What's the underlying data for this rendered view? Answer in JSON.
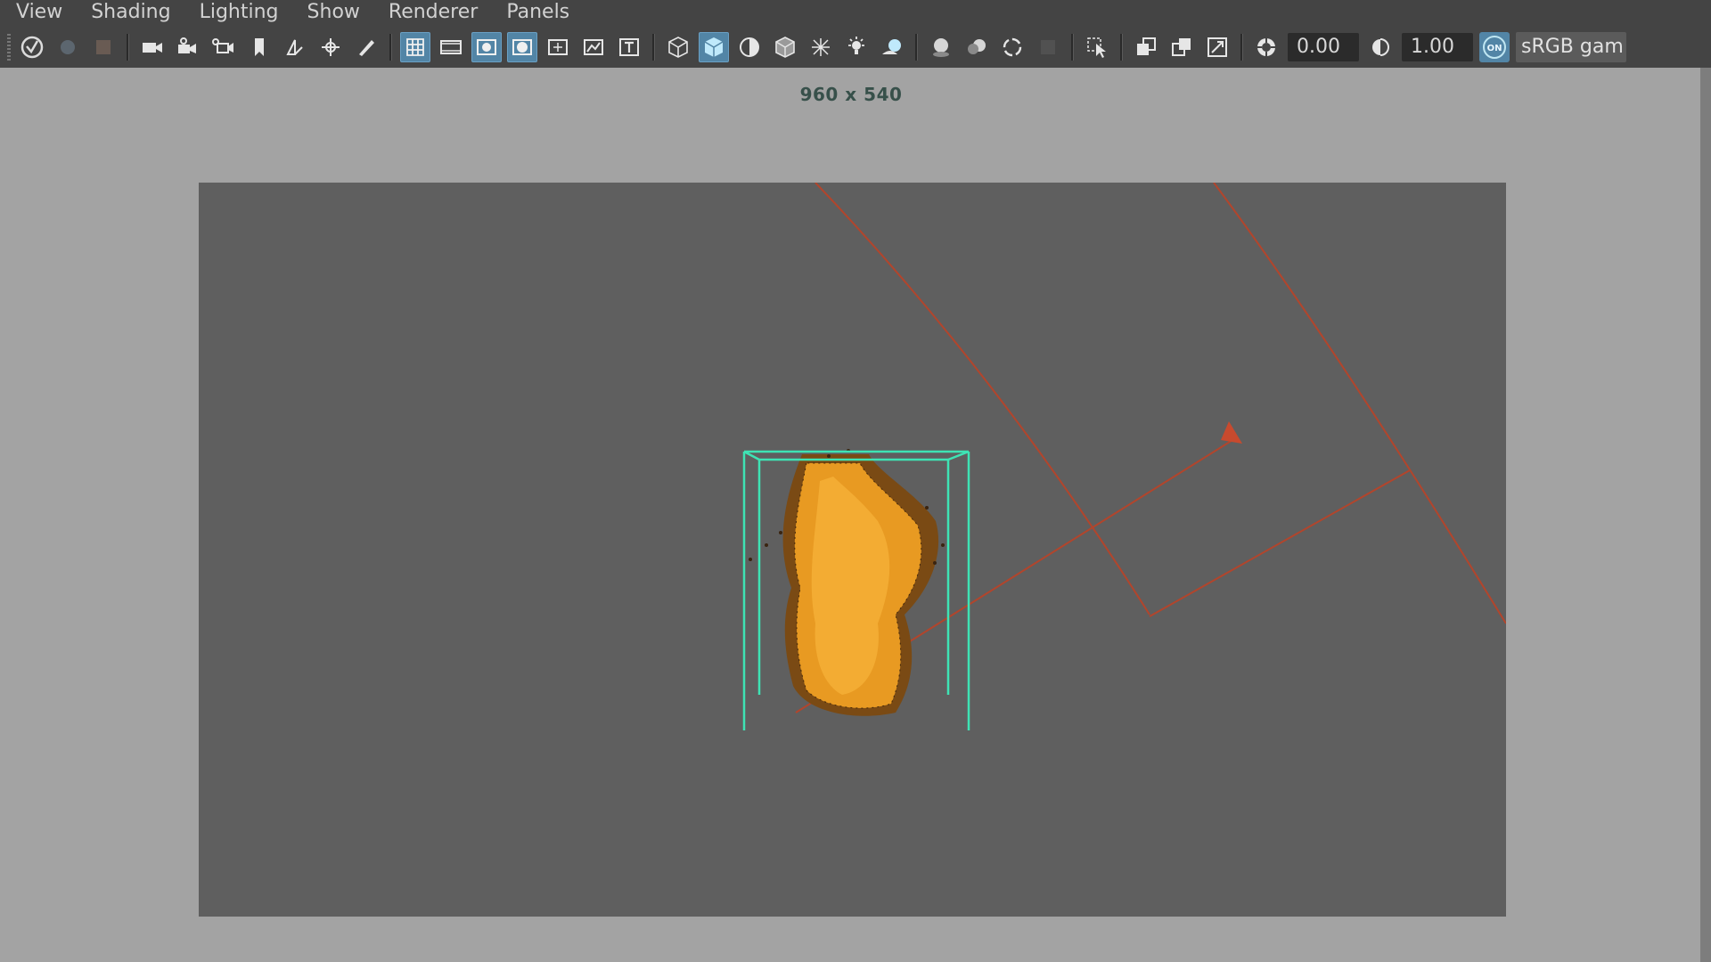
{
  "menu": [
    "View",
    "Shading",
    "Lighting",
    "Show",
    "Renderer",
    "Panels"
  ],
  "toolbar": {
    "groups": [
      [
        "select-camera-icon",
        "lock-camera-icon",
        "camera-attributes-icon"
      ],
      [
        "camera-icon",
        "camera-pan-icon",
        "camera-track-icon",
        "bookmark-icon",
        "image-plane-icon",
        "two-d-pan-icon",
        "grease-pencil-icon"
      ],
      [
        "grid-icon",
        "film-gate-icon",
        "resolution-gate-icon",
        "gate-mask-icon",
        "field-chart-icon",
        "safe-action-icon",
        "safe-title-icon"
      ],
      [
        "wireframe-icon",
        "smooth-shade-icon",
        "default-material-icon",
        "wireframe-on-shaded-icon",
        "xray-icon",
        "use-lights-icon",
        "shadows-icon"
      ],
      [
        "screen-space-ao-icon",
        "motion-blur-icon",
        "anti-aliasing-icon",
        "depth-of-field-icon"
      ],
      [
        "isolate-select-icon"
      ],
      [
        "xray-active-icon",
        "xray-joints-icon",
        "backface-cull-icon"
      ],
      [
        "exposure-icon"
      ]
    ],
    "exposure_value": "0.00",
    "gamma_value": "1.00",
    "color_management_badge": "ON",
    "color_space_label": "sRGB gam"
  },
  "viewport": {
    "resolution_label": "960 x 540"
  },
  "colors": {
    "bounding_box": "#3ee3b4",
    "light_manipulator": "#b2452c",
    "fire_particles": "#f0a020",
    "active_button": "#5285a6"
  }
}
